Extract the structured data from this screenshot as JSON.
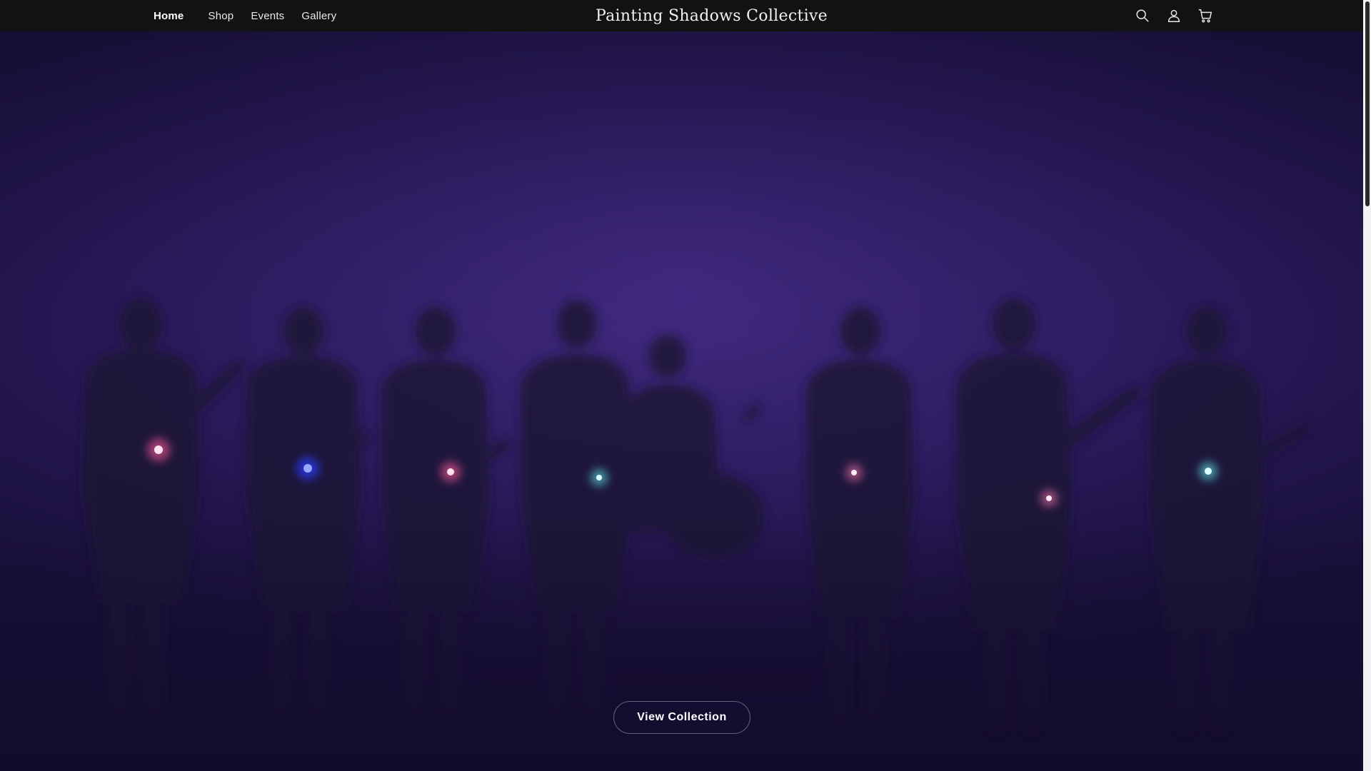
{
  "header": {
    "nav": [
      {
        "label": "Home",
        "active": true
      },
      {
        "label": "Shop"
      },
      {
        "label": "Events"
      },
      {
        "label": "Gallery"
      }
    ],
    "brand": "Painting Shadows Collective",
    "icons": [
      "search-icon",
      "account-icon",
      "cart-icon"
    ]
  },
  "hero": {
    "cta_label": "View Collection",
    "colors": {
      "haze": "#2c1c60",
      "glow_pink": "#ff5a9a",
      "glow_blue": "#2a3cff",
      "glow_teal": "#5fe6e6"
    }
  }
}
